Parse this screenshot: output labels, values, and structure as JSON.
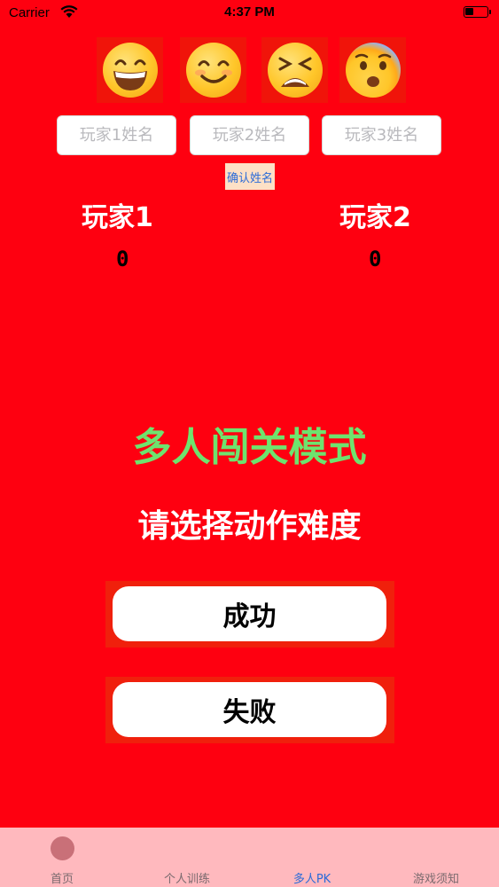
{
  "status_bar": {
    "carrier": "Carrier",
    "time": "4:37 PM"
  },
  "emojis": [
    {
      "icon": "grinning-face-icon",
      "label": "😄"
    },
    {
      "icon": "smiling-face-icon",
      "label": "😊"
    },
    {
      "icon": "tired-face-icon",
      "label": "😫"
    },
    {
      "icon": "fearful-face-icon",
      "label": "😨"
    }
  ],
  "name_inputs": [
    {
      "placeholder": "玩家1姓名",
      "value": ""
    },
    {
      "placeholder": "玩家2姓名",
      "value": ""
    },
    {
      "placeholder": "玩家3姓名",
      "value": ""
    }
  ],
  "confirm_label": "确认姓名",
  "players": [
    {
      "label": "玩家1",
      "score": "0"
    },
    {
      "label": "玩家2",
      "score": "0"
    }
  ],
  "mode_title": "多人闯关模式",
  "subtitle": "请选择动作难度",
  "buttons": {
    "success": "成功",
    "fail": "失败"
  },
  "tabs": [
    {
      "label": "首页",
      "active": false
    },
    {
      "label": "个人训练",
      "active": false
    },
    {
      "label": "多人PK",
      "active": true
    },
    {
      "label": "游戏须知",
      "active": false
    }
  ],
  "colors": {
    "background": "#fe0010",
    "mode_title": "#6ee36e",
    "tab_bar": "#ffb9be",
    "active_tab": "#2a6bd8"
  }
}
